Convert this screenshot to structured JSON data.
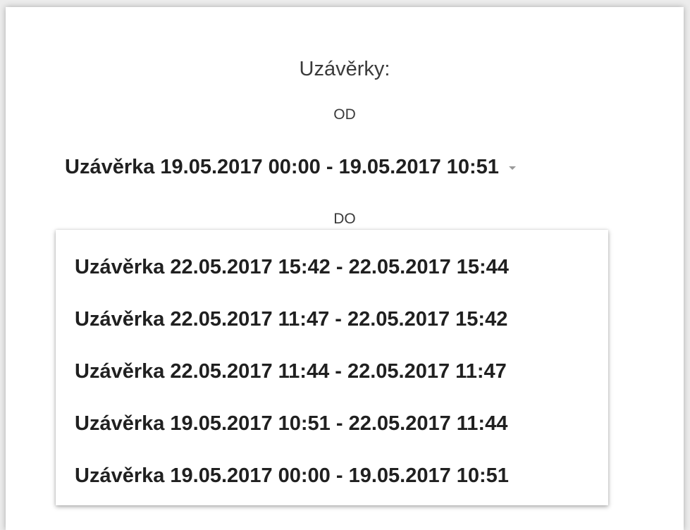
{
  "header": {
    "title": "Uzávěrky:"
  },
  "from": {
    "label": "OD",
    "selected_value": "Uzávěrka 19.05.2017 00:00 - 19.05.2017 10:51"
  },
  "to": {
    "label": "DO",
    "options": [
      "Uzávěrka 22.05.2017 15:42 - 22.05.2017 15:44",
      "Uzávěrka 22.05.2017 11:47 - 22.05.2017 15:42",
      "Uzávěrka 22.05.2017 11:44 - 22.05.2017 11:47",
      "Uzávěrka 19.05.2017 10:51 - 22.05.2017 11:44",
      "Uzávěrka 19.05.2017 00:00 - 19.05.2017 10:51"
    ]
  },
  "colors": {
    "page_background": "#ececec",
    "card_background": "#ffffff",
    "text_primary": "#202020",
    "text_secondary": "#3a3a3a",
    "caret": "#9a9a9a"
  },
  "icons": {
    "dropdown_caret": "chevron-down-icon"
  }
}
